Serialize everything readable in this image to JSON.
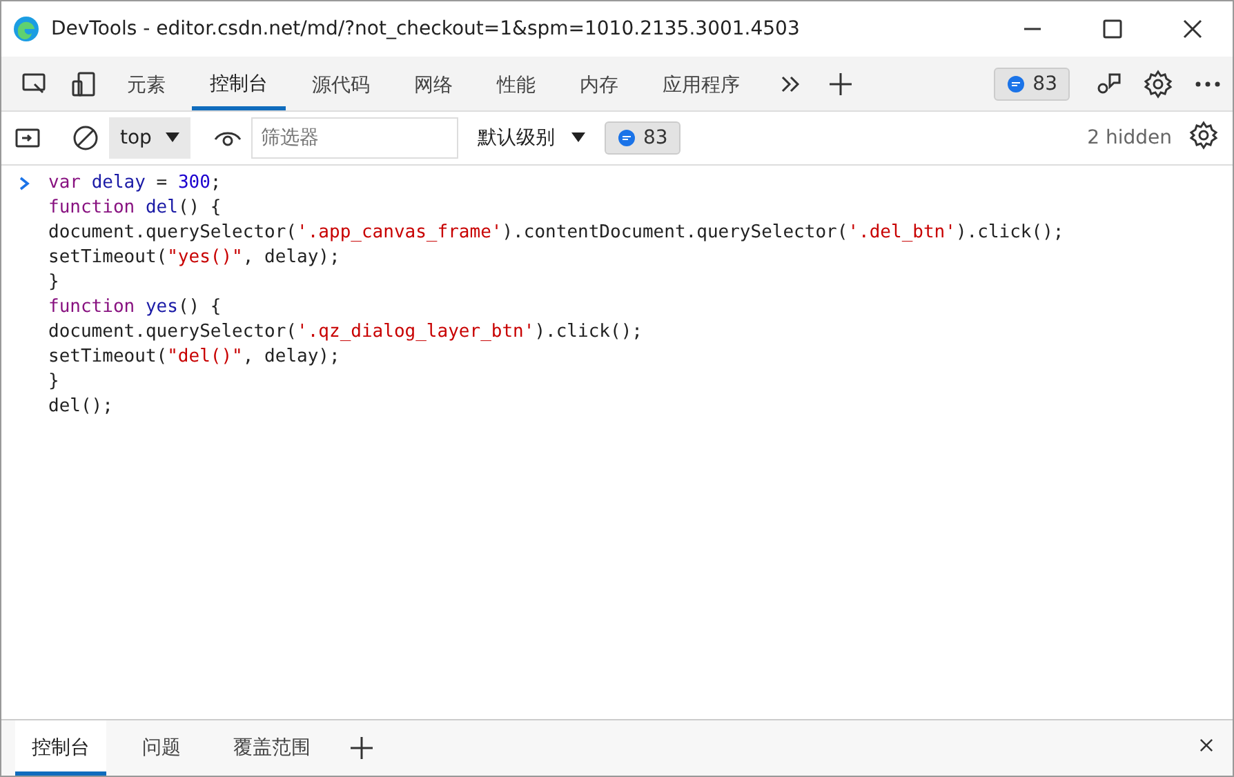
{
  "window": {
    "title": "DevTools - editor.csdn.net/md/?not_checkout=1&spm=1010.2135.3001.4503"
  },
  "tabs": [
    {
      "label": "元素",
      "selected": false
    },
    {
      "label": "控制台",
      "selected": true
    },
    {
      "label": "源代码",
      "selected": false
    },
    {
      "label": "网络",
      "selected": false
    },
    {
      "label": "性能",
      "selected": false
    },
    {
      "label": "内存",
      "selected": false
    },
    {
      "label": "应用程序",
      "selected": false
    }
  ],
  "issues_badge": "83",
  "console_toolbar": {
    "context": "top",
    "filter": {
      "placeholder": "筛选器"
    },
    "level": "默认级别",
    "messages_badge": "83",
    "hidden": "2 hidden"
  },
  "console_lines": [
    [
      {
        "text": "var ",
        "kind": "keyword"
      },
      {
        "text": "delay",
        "kind": "def"
      },
      {
        "text": " = ",
        "kind": "plain"
      },
      {
        "text": "300",
        "kind": "number"
      },
      {
        "text": ";",
        "kind": "plain"
      }
    ],
    [
      {
        "text": "function ",
        "kind": "keyword"
      },
      {
        "text": "del",
        "kind": "def"
      },
      {
        "text": "() {",
        "kind": "plain"
      }
    ],
    [
      {
        "text": "document.querySelector(",
        "kind": "plain"
      },
      {
        "text": "'.app_canvas_frame'",
        "kind": "string"
      },
      {
        "text": ").contentDocument.querySelector(",
        "kind": "plain"
      },
      {
        "text": "'.del_btn'",
        "kind": "string"
      },
      {
        "text": ").click();",
        "kind": "plain"
      }
    ],
    [
      {
        "text": "setTimeout(",
        "kind": "plain"
      },
      {
        "text": "\"yes()\"",
        "kind": "string"
      },
      {
        "text": ", delay);",
        "kind": "plain"
      }
    ],
    [
      {
        "text": "}",
        "kind": "plain"
      }
    ],
    [
      {
        "text": "function ",
        "kind": "keyword"
      },
      {
        "text": "yes",
        "kind": "def"
      },
      {
        "text": "() {",
        "kind": "plain"
      }
    ],
    [
      {
        "text": "document.querySelector(",
        "kind": "plain"
      },
      {
        "text": "'.qz_dialog_layer_btn'",
        "kind": "string"
      },
      {
        "text": ").click();",
        "kind": "plain"
      }
    ],
    [
      {
        "text": "setTimeout(",
        "kind": "plain"
      },
      {
        "text": "\"del()\"",
        "kind": "string"
      },
      {
        "text": ", delay);",
        "kind": "plain"
      }
    ],
    [
      {
        "text": "}",
        "kind": "plain"
      }
    ],
    [
      {
        "text": "del();",
        "kind": "plain"
      }
    ]
  ],
  "drawer_tabs": [
    {
      "label": "控制台",
      "selected": true
    },
    {
      "label": "问题",
      "selected": false
    },
    {
      "label": "覆盖范围",
      "selected": false
    }
  ]
}
